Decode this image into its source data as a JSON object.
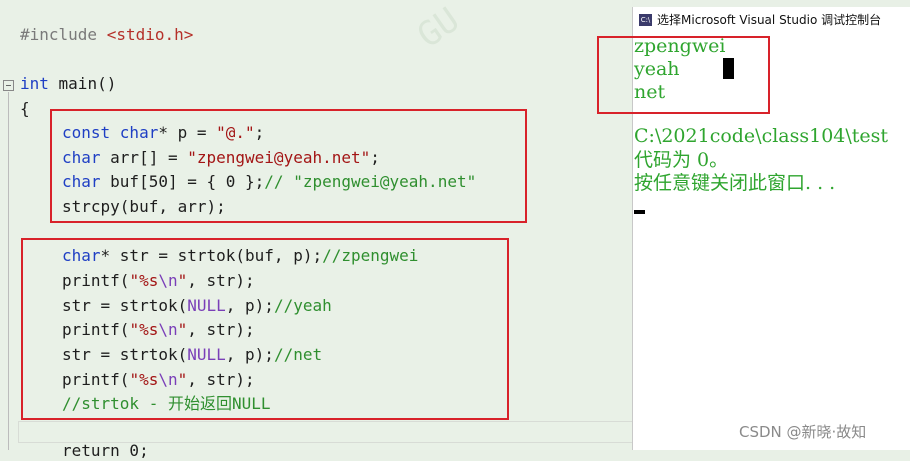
{
  "editor": {
    "include_directive": "#include",
    "include_header": "<stdio.h>",
    "main": {
      "type": "int",
      "name": " main()"
    },
    "open_brace": "{",
    "lines": [
      {
        "kw": "const char",
        "rest": "* p = ",
        "str": "\"@.\"",
        "tail": ";"
      },
      {
        "kw": "char",
        "rest": " arr[] = ",
        "str": "\"zpengwei@yeah.net\"",
        "tail": ";"
      },
      {
        "kw": "char",
        "rest": " buf[50] = { 0 };",
        "cm": "// \"zpengwei@yeah.net\""
      },
      {
        "plain": "strcpy(buf, arr);"
      },
      {
        "kw": "char",
        "rest": "* str = strtok(buf, p);",
        "cm": "//zpengwei"
      },
      {
        "fn": "printf(",
        "str1": "\"%s",
        "esc": "\\n",
        "str2": "\"",
        "tail": ", str);"
      },
      {
        "pre": "str = strtok(",
        "mac": "NULL",
        "post": ", p);",
        "cm": "//yeah"
      },
      {
        "fn": "printf(",
        "str1": "\"%s",
        "esc": "\\n",
        "str2": "\"",
        "tail": ", str);"
      },
      {
        "pre": "str = strtok(",
        "mac": "NULL",
        "post": ", p);",
        "cm": "//net"
      },
      {
        "fn": "printf(",
        "str1": "\"%s",
        "esc": "\\n",
        "str2": "\"",
        "tail": ", str);"
      },
      {
        "cm": "//strtok - 开始返回NULL"
      }
    ],
    "return_line": "return 0;"
  },
  "console": {
    "title": "选择Microsoft Visual Studio 调试控制台",
    "icon_label": "C:\\",
    "output": [
      "zpengwei",
      "yeah",
      "net"
    ],
    "path_line": "C:\\2021code\\class104\\test",
    "exit_line": "代码为 0。",
    "close_hint": "按任意键关闭此窗口. . ."
  },
  "credit": "CSDN @新晓·故知",
  "watermark": "GU"
}
